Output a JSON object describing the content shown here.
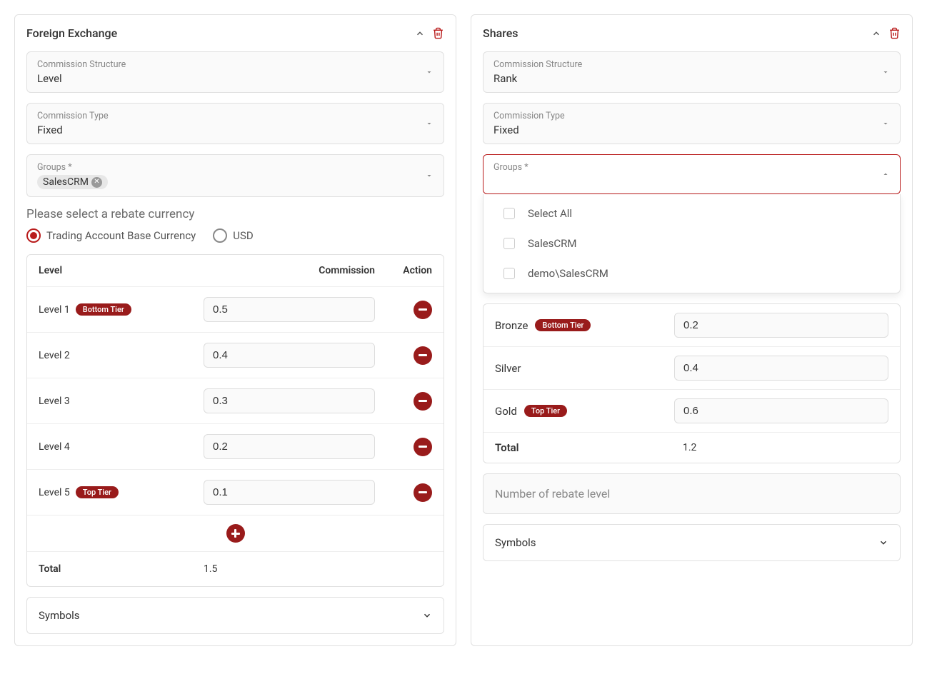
{
  "left": {
    "title": "Foreign Exchange",
    "commission_structure_label": "Commission Structure",
    "commission_structure_value": "Level",
    "commission_type_label": "Commission Type",
    "commission_type_value": "Fixed",
    "groups_label": "Groups *",
    "groups_chip": "SalesCRM",
    "currency_title": "Please select a rebate currency",
    "radio1": "Trading Account Base Currency",
    "radio2": "USD",
    "table": {
      "col_level": "Level",
      "col_commission": "Commission",
      "col_action": "Action",
      "rows": [
        {
          "label": "Level 1",
          "badge": "Bottom Tier",
          "value": "0.5"
        },
        {
          "label": "Level 2",
          "badge": "",
          "value": "0.4"
        },
        {
          "label": "Level 3",
          "badge": "",
          "value": "0.3"
        },
        {
          "label": "Level 4",
          "badge": "",
          "value": "0.2"
        },
        {
          "label": "Level 5",
          "badge": "Top Tier",
          "value": "0.1"
        }
      ],
      "total_label": "Total",
      "total_value": "1.5"
    },
    "symbols_label": "Symbols"
  },
  "right": {
    "title": "Shares",
    "commission_structure_label": "Commission Structure",
    "commission_structure_value": "Rank",
    "commission_type_label": "Commission Type",
    "commission_type_value": "Fixed",
    "groups_label": "Groups *",
    "dropdown": {
      "select_all": "Select All",
      "opt1": "SalesCRM",
      "opt2": "demo\\SalesCRM"
    },
    "ranks": [
      {
        "label": "Bronze",
        "badge": "Bottom Tier",
        "value": "0.2"
      },
      {
        "label": "Silver",
        "badge": "",
        "value": "0.4"
      },
      {
        "label": "Gold",
        "badge": "Top Tier",
        "value": "0.6"
      }
    ],
    "total_label": "Total",
    "total_value": "1.2",
    "rebate_level_placeholder": "Number of rebate level",
    "symbols_label": "Symbols"
  }
}
